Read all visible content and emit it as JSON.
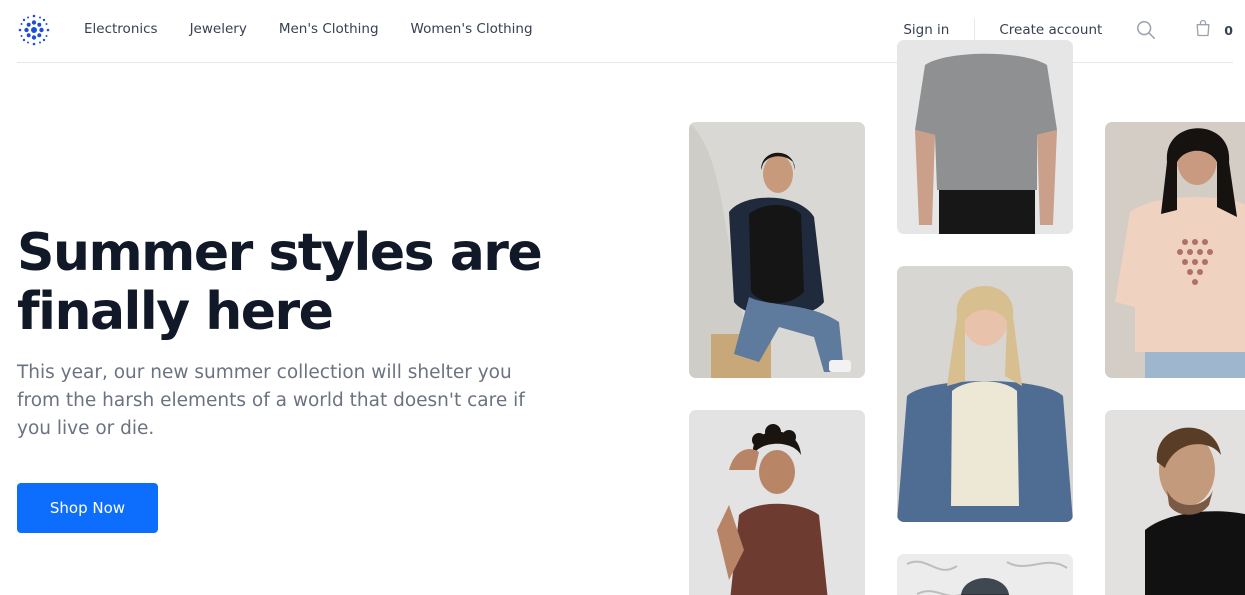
{
  "header": {
    "logo_icon": "starburst-logo-icon",
    "nav": [
      {
        "label": "Electronics"
      },
      {
        "label": "Jewelery"
      },
      {
        "label": "Men's Clothing"
      },
      {
        "label": "Women's Clothing"
      }
    ],
    "sign_in": "Sign in",
    "create_account": "Create account",
    "search_icon": "search-icon",
    "cart_icon": "shopping-bag-icon",
    "cart_count": "0"
  },
  "hero": {
    "title_line1": "Summer styles are",
    "title_line2": "finally here",
    "description": "This year, our new summer collection will shelter you from the harsh elements of a world that doesn't care if you live or die.",
    "cta": "Shop Now"
  },
  "colors": {
    "accent": "#0d6efd",
    "heading": "#111827",
    "body_text": "#6b7280"
  }
}
